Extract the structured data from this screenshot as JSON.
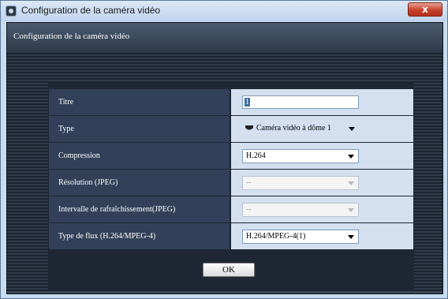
{
  "window": {
    "title": "Configuration de la caméra vidéo",
    "close_label": "x"
  },
  "dialog": {
    "heading": "Configuration de la caméra vidéo"
  },
  "form": {
    "rows": [
      {
        "label": "Titre",
        "value": "1",
        "control": "text"
      },
      {
        "label": "Type",
        "value": "Caméra vidéo à dôme 1",
        "control": "select-icon"
      },
      {
        "label": "Compression",
        "value": "H.264",
        "control": "select"
      },
      {
        "label": "Résolution (JPEG)",
        "value": "--",
        "control": "select-disabled"
      },
      {
        "label": "Intervalle de rafraîchissement(JPEG)",
        "value": "--",
        "control": "select-disabled"
      },
      {
        "label": "Type de flux (H.264/MPEG-4)",
        "value": "H.264/MPEG-4(1)",
        "control": "select"
      }
    ]
  },
  "buttons": {
    "ok_label": "OK"
  },
  "icons": {
    "app": "camera-app-icon",
    "camera": "dome-camera-icon",
    "dropdown": "chevron-down-icon"
  }
}
